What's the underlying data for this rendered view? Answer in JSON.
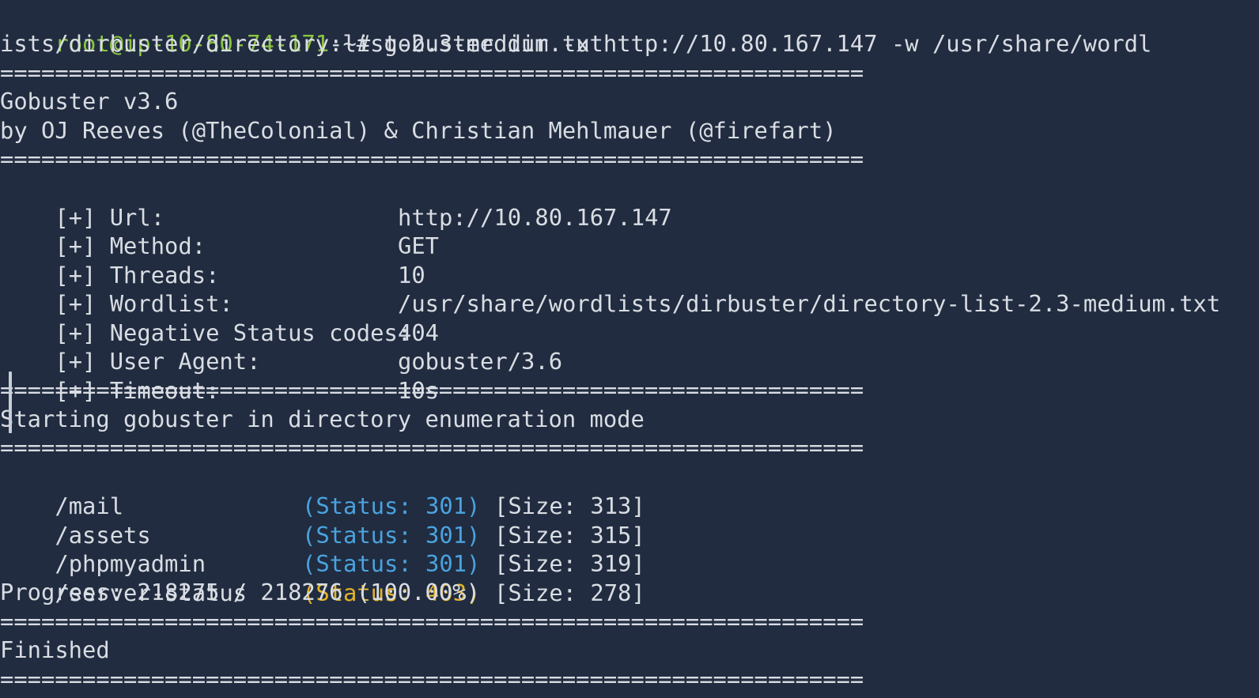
{
  "colors": {
    "background": "#212c40",
    "text": "#d9dde3",
    "prompt_user": "#8bc53f",
    "status_301": "#4aa3df",
    "status_403": "#e4b429"
  },
  "command": {
    "prompt_user": "root@ip-10-80-74-171",
    "prompt_suffix": ":~# ",
    "text_line1": "gobuster dir -u http://10.80.167.147 -w /usr/share/wordl",
    "text_line2": "ists/dirbuster/directory-list-2.3-medium.txt"
  },
  "banner": {
    "title": "Gobuster v3.6",
    "authors": "by OJ Reeves (@TheColonial) & Christian Mehlmauer (@firefart)"
  },
  "separator": "===============================================================",
  "config": [
    {
      "label": "[+] Url:",
      "value": "http://10.80.167.147"
    },
    {
      "label": "[+] Method:",
      "value": "GET"
    },
    {
      "label": "[+] Threads:",
      "value": "10"
    },
    {
      "label": "[+] Wordlist:",
      "value": "/usr/share/wordlists/dirbuster/directory-list-2.3-medium.txt"
    },
    {
      "label": "[+] Negative Status codes:",
      "value": "404"
    },
    {
      "label": "[+] User Agent:",
      "value": "gobuster/3.6"
    },
    {
      "label": "[+] Timeout:",
      "value": "10s"
    }
  ],
  "start_message": "Starting gobuster in directory enumeration mode",
  "results": [
    {
      "path": "/mail",
      "status": "(Status: 301)",
      "size": "[Size: 313]"
    },
    {
      "path": "/assets",
      "status": "(Status: 301)",
      "size": "[Size: 315]"
    },
    {
      "path": "/phpmyadmin",
      "status": "(Status: 301)",
      "size": "[Size: 319]"
    },
    {
      "path": "/server-status",
      "status": "(Status: 403)",
      "size": "[Size: 278]"
    }
  ],
  "progress": "Progress: 218275 / 218276 (100.00%)",
  "finished": "Finished"
}
